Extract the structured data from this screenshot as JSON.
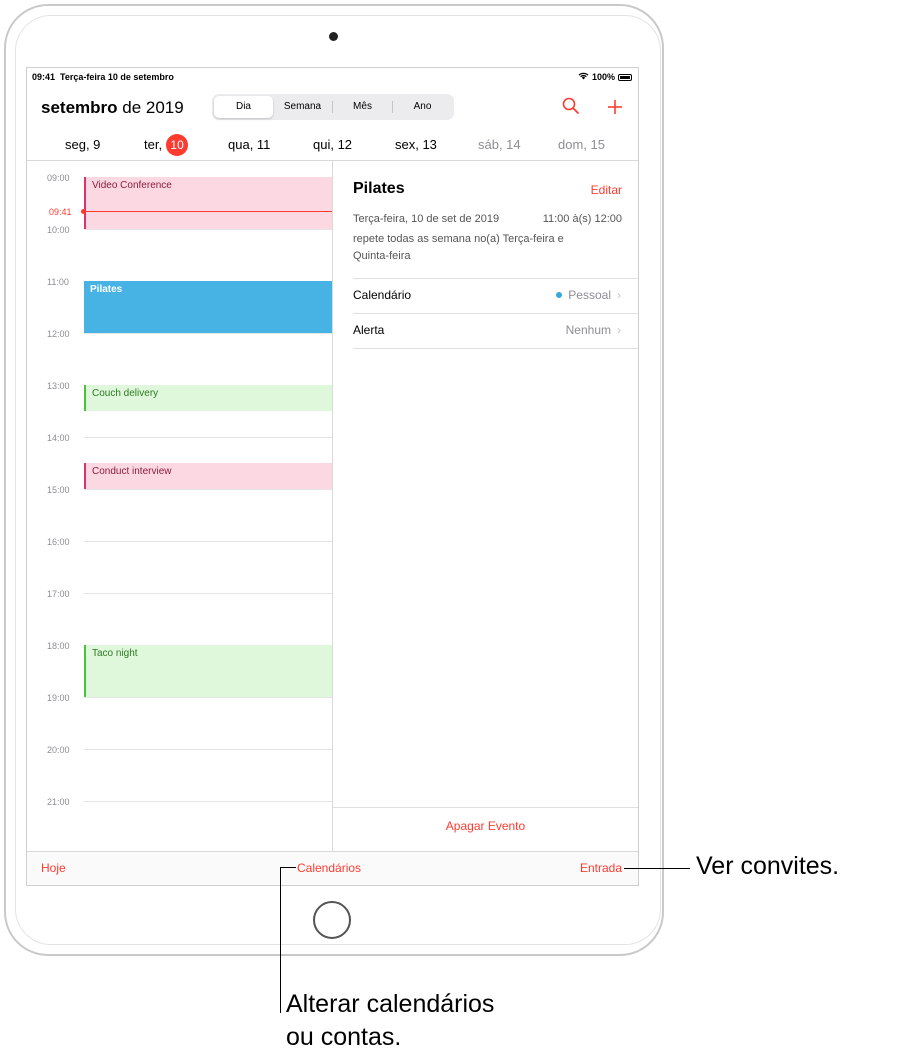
{
  "status": {
    "time": "09:41",
    "date": "Terça-feira 10 de setembro",
    "battery": "100%"
  },
  "header": {
    "month_bold": "setembro",
    "month_rest": "de 2019",
    "views": [
      "Dia",
      "Semana",
      "Mês",
      "Ano"
    ],
    "active_view": "Dia",
    "icons": [
      "search-icon",
      "plus-icon"
    ]
  },
  "days": [
    {
      "label": "seg, 9"
    },
    {
      "label": "ter,",
      "number": "10",
      "today": true
    },
    {
      "label": "qua, 11"
    },
    {
      "label": "qui, 12"
    },
    {
      "label": "sex, 13"
    },
    {
      "label": "sáb, 14",
      "weekend": true
    },
    {
      "label": "dom, 15",
      "weekend": true
    }
  ],
  "timeline": {
    "hours": [
      "09:00",
      "10:00",
      "11:00",
      "12:00",
      "13:00",
      "14:00",
      "15:00",
      "16:00",
      "17:00",
      "18:00",
      "19:00",
      "20:00",
      "21:00"
    ],
    "now": "09:41",
    "events": [
      {
        "title": "Video Conference",
        "start": "09:00",
        "end": "10:00",
        "color": "#fcd9e2"
      },
      {
        "title": "Pilates",
        "start": "11:00",
        "end": "12:00",
        "color": "#47b3e5"
      },
      {
        "title": "Couch delivery",
        "start": "13:00",
        "end": "13:30",
        "color": "#dff7da"
      },
      {
        "title": "Conduct interview",
        "start": "14:30",
        "end": "15:00",
        "color": "#fcd9e2"
      },
      {
        "title": "Taco night",
        "start": "18:00",
        "end": "19:00",
        "color": "#dff7da"
      }
    ]
  },
  "detail": {
    "title": "Pilates",
    "edit": "Editar",
    "date": "Terça-feira, 10 de set de 2019",
    "time": "11:00 à(s) 12:00",
    "repeat_line1": "repete todas as semana no(a) Terça-feira e",
    "repeat_line2": "Quinta-feira",
    "calendar_label": "Calendário",
    "calendar_value": "Pessoal",
    "alert_label": "Alerta",
    "alert_value": "Nenhum",
    "delete": "Apagar Evento"
  },
  "tabbar": {
    "today": "Hoje",
    "calendars": "Calendários",
    "inbox": "Entrada"
  },
  "callouts": {
    "inbox": "Ver convites.",
    "calendars_line1": "Alterar calendários",
    "calendars_line2": "ou contas."
  },
  "colors": {
    "accent": "#ff3b30",
    "pilates": "#47b3e5"
  }
}
